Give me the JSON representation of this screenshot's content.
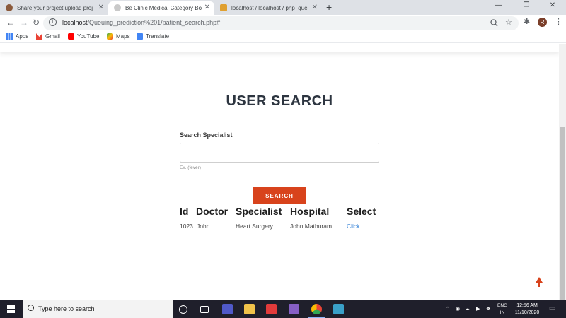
{
  "browser": {
    "tabs": [
      {
        "label": "Share your project|upload projec",
        "favicon_color": "#8b5a3c",
        "active": false
      },
      {
        "label": "Be Clinic Medical Category Boots",
        "favicon_color": "#c9c9c9",
        "active": true
      },
      {
        "label": "localhost / localhost / php_queui",
        "favicon_color": "#e0a030",
        "active": false
      }
    ],
    "close_glyph": "✕",
    "new_tab_glyph": "+",
    "url_host": "localhost",
    "url_path": "/Queuing_prediction%201/patient_search.php#",
    "profile_initial": "R",
    "bookmarks": [
      {
        "label": "Apps",
        "icon": "apps-grid-icon",
        "color": "#4285f4"
      },
      {
        "label": "Gmail",
        "icon": "gmail-icon",
        "color": "#ea4335"
      },
      {
        "label": "YouTube",
        "icon": "youtube-icon",
        "color": "#ff0000"
      },
      {
        "label": "Maps",
        "icon": "maps-icon",
        "color": "#34a853"
      },
      {
        "label": "Translate",
        "icon": "translate-icon",
        "color": "#4285f4"
      }
    ]
  },
  "page": {
    "title": "USER SEARCH",
    "search": {
      "label": "Search Specialist",
      "value": "",
      "placeholder": "",
      "hint": "Ex. (fever)",
      "button_label": "SEARCH"
    },
    "results": {
      "columns": [
        "Id",
        "Doctor",
        "Specialist",
        "Hospital",
        "Select"
      ],
      "rows": [
        {
          "id": "1023",
          "doctor": "John",
          "specialist": "Heart Surgery",
          "hospital": "John Mathuram",
          "select": "Click..."
        }
      ]
    },
    "accent_color": "#d8431c"
  },
  "taskbar": {
    "search_text": "Type here to search",
    "lang_top": "ENG",
    "lang_bottom": "IN",
    "time": "12:56 AM",
    "date": "11/10/2020"
  }
}
